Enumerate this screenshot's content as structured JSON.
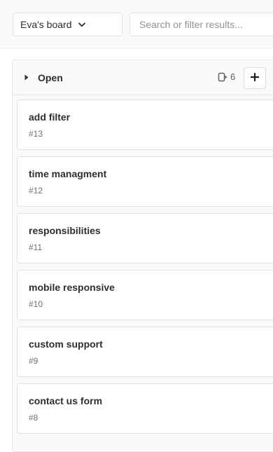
{
  "header": {
    "board_name": "Eva's board",
    "search_placeholder": "Search or filter results..."
  },
  "list": {
    "title": "Open",
    "issue_count": "6",
    "add_label": "+"
  },
  "cards": [
    {
      "title": "add filter",
      "id": "#13"
    },
    {
      "title": "time managment",
      "id": "#12"
    },
    {
      "title": "responsibilities",
      "id": "#11"
    },
    {
      "title": "mobile responsive",
      "id": "#10"
    },
    {
      "title": "custom support",
      "id": "#9"
    },
    {
      "title": "contact us form",
      "id": "#8"
    }
  ],
  "icons": {
    "board_dropdown": "chevron-down-icon",
    "list_toggle": "caret-right-icon",
    "issue_count": "issues-icon",
    "add": "plus-icon"
  }
}
